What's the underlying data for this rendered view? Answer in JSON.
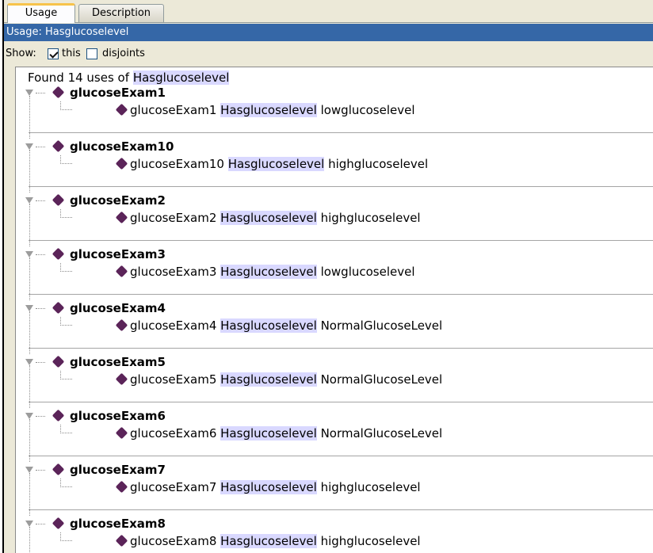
{
  "tabs": [
    {
      "label": "Usage",
      "active": true
    },
    {
      "label": "Description",
      "active": false
    }
  ],
  "panel_title": "Usage: Hasglucoselevel",
  "show": {
    "label": "Show:",
    "options": [
      {
        "label": "this",
        "checked": true
      },
      {
        "label": "disjoints",
        "checked": false
      }
    ]
  },
  "found": {
    "prefix": "Found 14 uses of",
    "property": "Hasglucoselevel"
  },
  "usages": [
    {
      "individual": "glucoseExam1",
      "subject": "glucoseExam1",
      "property": "Hasglucoselevel",
      "object": "lowglucoselevel"
    },
    {
      "individual": "glucoseExam10",
      "subject": "glucoseExam10",
      "property": "Hasglucoselevel",
      "object": "highglucoselevel"
    },
    {
      "individual": "glucoseExam2",
      "subject": "glucoseExam2",
      "property": "Hasglucoselevel",
      "object": "highglucoselevel"
    },
    {
      "individual": "glucoseExam3",
      "subject": "glucoseExam3",
      "property": "Hasglucoselevel",
      "object": "lowglucoselevel"
    },
    {
      "individual": "glucoseExam4",
      "subject": "glucoseExam4",
      "property": "Hasglucoselevel",
      "object": "NormalGlucoseLevel"
    },
    {
      "individual": "glucoseExam5",
      "subject": "glucoseExam5",
      "property": "Hasglucoselevel",
      "object": "NormalGlucoseLevel"
    },
    {
      "individual": "glucoseExam6",
      "subject": "glucoseExam6",
      "property": "Hasglucoselevel",
      "object": "NormalGlucoseLevel"
    },
    {
      "individual": "glucoseExam7",
      "subject": "glucoseExam7",
      "property": "Hasglucoselevel",
      "object": "highglucoselevel"
    },
    {
      "individual": "glucoseExam8",
      "subject": "glucoseExam8",
      "property": "Hasglucoselevel",
      "object": "highglucoselevel"
    }
  ],
  "colors": {
    "title_bar": "#3567a7",
    "highlight": "#d9d8ff",
    "individual_diamond": "#5b2459",
    "tab_accent": "#f7c34b"
  }
}
